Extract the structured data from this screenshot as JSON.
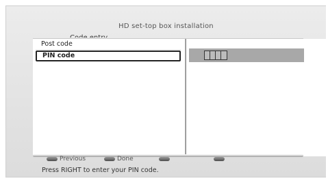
{
  "header": {
    "title": "HD set-top box installation",
    "subtitle": "Code entry"
  },
  "menu": {
    "items": [
      {
        "label": "Post code",
        "selected": false
      },
      {
        "label": "PIN code",
        "selected": true
      }
    ]
  },
  "pin": {
    "cell_count": 4
  },
  "legend": {
    "previous_label": "Previous",
    "done_label": "Done"
  },
  "hint": "Press RIGHT to enter your PIN code."
}
